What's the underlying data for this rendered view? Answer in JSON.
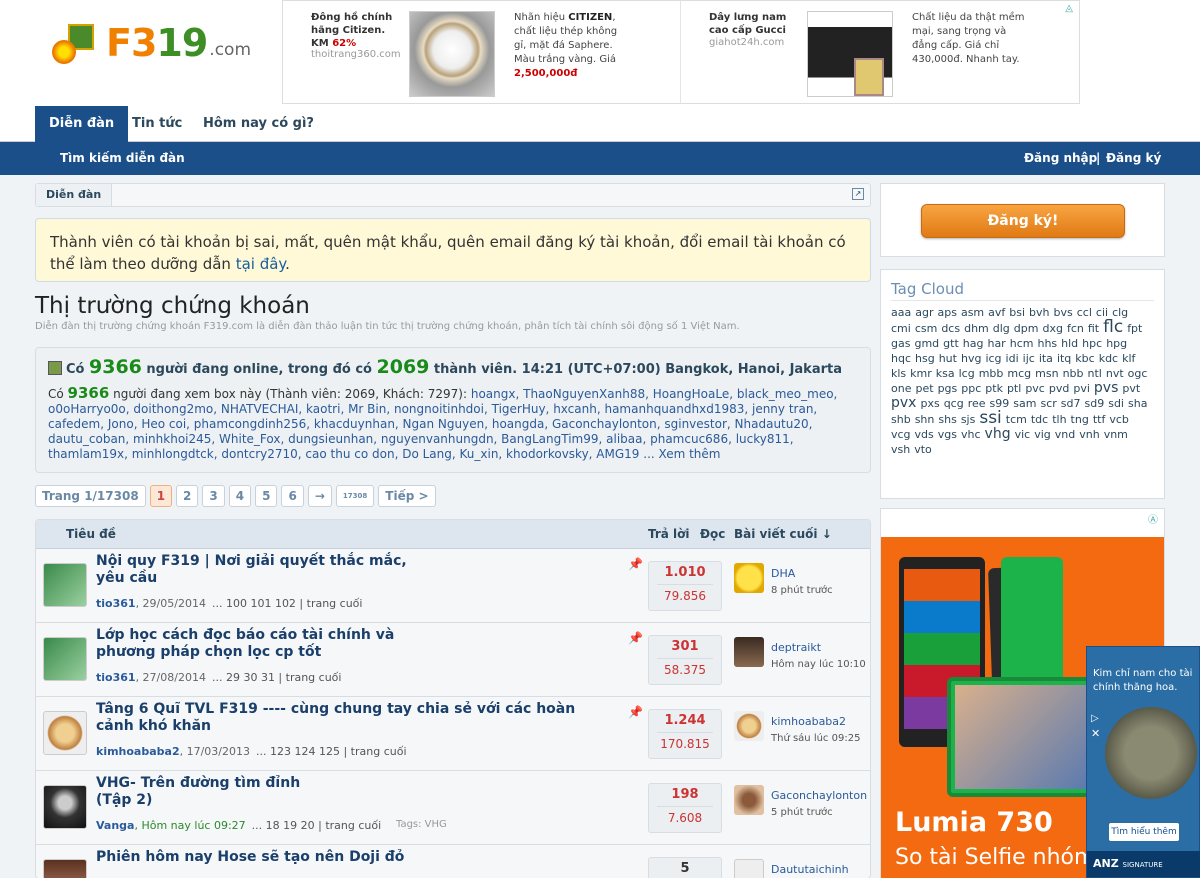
{
  "logo": {
    "text_main": "F3",
    "text_mid": "19",
    "text_suffix": ".com"
  },
  "ads_top": [
    {
      "title": "Đông hồ chính hãng Citizen. KM ",
      "discount": "62%",
      "domain": "thoitrang360.com",
      "desc_pre": "Nhãn hiệu ",
      "brand": "CITIZEN",
      "desc_post": ", chất liệu thép không gỉ, mặt đá Saphere. Màu trắng vàng. Giá",
      "price": "2,500,000đ"
    },
    {
      "title": "Dây lưng nam cao cấp Gucci",
      "domain": "giahot24h.com",
      "desc": "Chất liệu da thật mềm mại, sang trọng và đẳng cấp. Giá chỉ 430,000đ. Nhanh tay."
    }
  ],
  "nav": {
    "tabs": [
      "Diễn đàn",
      "Tin tức",
      "Hôm nay có gì?"
    ]
  },
  "subnav": {
    "search": "Tìm kiếm diễn đàn",
    "login": "Đăng nhập",
    "sep": "|",
    "register": "Đăng ký"
  },
  "breadcrumb": {
    "item": "Diễn đàn",
    "jump_icon": "↗"
  },
  "notice": {
    "text": "Thành viên có tài khoản bị sai, mất, quên mật khẩu, quên email đăng ký tài khoản, đổi email tài khoản có thể làm theo dưỡng dẫn ",
    "link": "tại đây",
    "end": "."
  },
  "page": {
    "title": "Thị trường chứng khoán",
    "description": "Diễn đàn thị trường chứng khoán F319.com là diễn đàn thảo luận tin tức thị trường chứng khoán, phân tích tài chính sôi động số 1 Việt Nam."
  },
  "online": {
    "h1": "Có ",
    "total": "9366",
    "h2": " người đang online, trong đó có ",
    "members": "2069",
    "h3": " thành viên. 14:21 (UTC+07:00) Bangkok, Hanoi, Jakarta",
    "b1": "Có ",
    "viewing": "9366",
    "b2": " người đang xem box này (Thành viên: 2069, Khách: 7297): ",
    "users": "hoangx, ThaoNguyenXanh88, HoangHoaLe, black_meo_meo, o0oHarryo0o, doithong2mo, NHATVECHAI, kaotri, Mr Bin, nongnoitinhdoi, TigerHuy, hxcanh, hamanhquandhxd1983, jenny tran, cafedem, Jono, Heo coi, phamcongdinh256, khacduynhan, Ngan Nguyen, hoangda, Gaconchaylonton, sginvestor, Nhadautu20, dautu_coban, minhkhoi245, White_Fox, dungsieunhan, nguyenvanhungdn, BangLangTim99, alibaa, phamcuc686, lucky811, thamlam19x, minhlongdtck, dontcry2710, cao thu co don, Do Lang, Ku_xin, khodorkovsky, AMG19",
    "more": " ... Xem thêm"
  },
  "pager": {
    "label": "Trang 1/17308",
    "pages": [
      "1",
      "2",
      "3",
      "4",
      "5",
      "6"
    ],
    "arrow": "→",
    "last": "17308",
    "next": "Tiếp >"
  },
  "table": {
    "headers": {
      "title": "Tiêu đề",
      "replies": "Trả lời",
      "views": "Đọc",
      "last": "Bài viết cuối ↓"
    },
    "rows": [
      {
        "title": "Nội quy F319 | Nơi giải quyết thắc mắc, yêu cầu",
        "author": "tio361",
        "date": ", 29/05/2014",
        "pages": "...  100  101  102  |  trang cuối",
        "replies": "1.010",
        "views": "79.856",
        "lp_user": "DHA",
        "lp_time": "8 phút trước",
        "pinned": "📌"
      },
      {
        "title": "Lớp học cách đọc báo cáo tài chính và phương pháp chọn lọc cp tốt",
        "author": "tio361",
        "date": ", 27/08/2014",
        "pages": "...  29  30  31  |  trang cuối",
        "replies": "301",
        "views": "58.375",
        "lp_user": "deptraikt",
        "lp_time": "Hôm nay lúc 10:10",
        "pinned": "📌"
      },
      {
        "title": "Tâng 6 Quĩ TVL F319 ---- cùng chung tay chia sẻ với các hoàn cảnh khó khăn",
        "author": "kimhoababa2",
        "date": ", 17/03/2013",
        "pages": "...  123  124  125  |  trang cuối",
        "replies": "1.244",
        "views": "170.815",
        "lp_user": "kimhoababa2",
        "lp_time": "Thứ sáu lúc 09:25",
        "pinned": "📌"
      },
      {
        "title": "VHG- Trên đường tìm đỉnh (Tập 2)",
        "author": "Vanga",
        "date": ", Hôm nay lúc 09:27",
        "pages": "...  18  19  20  |  trang cuối",
        "replies": "198",
        "views": "7.608",
        "lp_user": "Gaconchaylonton",
        "lp_time": "5 phút trước",
        "tags": "Tags: VHG"
      },
      {
        "title": "Phiên hôm nay Hose sẽ tạo nên Doji đỏ",
        "author": "",
        "date": "",
        "pages": "",
        "replies": "5",
        "views": "",
        "lp_user": "Daututaichinh",
        "lp_time": ""
      }
    ]
  },
  "sidebar": {
    "register": "Đăng ký!",
    "tagcloud_title": "Tag Cloud",
    "tags": [
      "aaa",
      "agr",
      "aps",
      "asm",
      "avf",
      "bsi",
      "bvh",
      "bvs",
      "ccl",
      "cii",
      "clg",
      "cmi",
      "csm",
      "dcs",
      "dhm",
      "dlg",
      "dpm",
      "dxg",
      "fcn",
      "fit",
      "flc",
      "fpt",
      "gas",
      "gmd",
      "gtt",
      "hag",
      "har",
      "hcm",
      "hhs",
      "hld",
      "hpc",
      "hpg",
      "hqc",
      "hsg",
      "hut",
      "hvg",
      "icg",
      "idi",
      "ijc",
      "ita",
      "itq",
      "kbc",
      "kdc",
      "klf",
      "kls",
      "kmr",
      "ksa",
      "lcg",
      "mbb",
      "mcg",
      "msn",
      "nbb",
      "ntl",
      "nvt",
      "ogc",
      "one",
      "pet",
      "pgs",
      "ppc",
      "ptk",
      "ptl",
      "pvc",
      "pvd",
      "pvi",
      "pvs",
      "pvt",
      "pvx",
      "pxs",
      "qcg",
      "ree",
      "s99",
      "sam",
      "scr",
      "sd7",
      "sd9",
      "sdi",
      "sha",
      "shb",
      "shn",
      "shs",
      "sjs",
      "ssi",
      "tcm",
      "tdc",
      "tlh",
      "tng",
      "ttf",
      "vcb",
      "vcg",
      "vds",
      "vgs",
      "vhc",
      "vhg",
      "vic",
      "vig",
      "vnd",
      "vnh",
      "vnm",
      "vsh",
      "vto"
    ],
    "large_tags": [
      "flc",
      "ssi"
    ],
    "medium_tags": [
      "pvs",
      "pvx",
      "vhg"
    ]
  },
  "ad_side": {
    "title": "Lumia 730",
    "sub": "So tài Selfie nhóm",
    "adchoice": "Ⓐ"
  },
  "ad_float": {
    "text": "Kim chỉ nam cho tài chính thăng hoa.",
    "button": "Tìm hiểu thêm",
    "brand": "ANZ",
    "brand_sub": "SIGNATURE",
    "close": "✕",
    "adchoice": "▷"
  },
  "colors": {
    "nav": "#1a4f8a",
    "accent": "#f08000",
    "green": "#1a8a1a",
    "red": "#cc3333"
  }
}
